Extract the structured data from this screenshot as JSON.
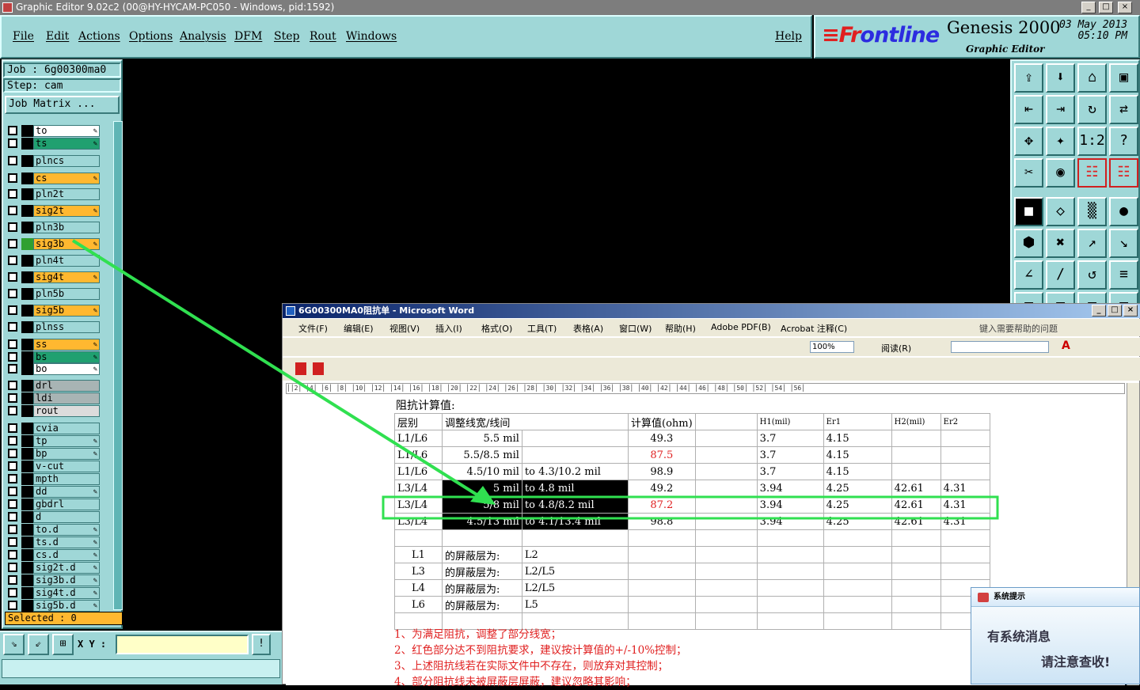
{
  "window": {
    "title": "Graphic Editor 9.02c2 (00@HY-HYCAM-PC050 - Windows, pid:1592)"
  },
  "menu": [
    "File",
    "Edit",
    "Actions",
    "Options",
    "Analysis",
    "DFM",
    "Step",
    "Rout",
    "Windows"
  ],
  "help": "Help",
  "brand": {
    "logo_a": "≡Fr",
    "logo_b": "ontline",
    "product": "Genesis 2000",
    "subtitle": "Graphic Editor",
    "date": "03 May 2013",
    "time": "05:10 PM"
  },
  "job": {
    "job": "Job : 6g00300ma0",
    "step": "Step: cam",
    "matrix": "Job Matrix ..."
  },
  "layers": [
    {
      "name": "to",
      "color": "#ffffff",
      "sw": "#000000",
      "pen": true
    },
    {
      "name": "ts",
      "color": "#20a070",
      "sw": "#000000",
      "pen": true
    },
    {
      "name": "plncs",
      "color": "#9fd7d7",
      "sw": "#000000",
      "pen": false
    },
    {
      "name": "cs",
      "color": "#ffb830",
      "sw": "#000000",
      "pen": true
    },
    {
      "name": "pln2t",
      "color": "#9fd7d7",
      "sw": "#000000",
      "pen": false
    },
    {
      "name": "sig2t",
      "color": "#ffb830",
      "sw": "#000000",
      "pen": true
    },
    {
      "name": "pln3b",
      "color": "#9fd7d7",
      "sw": "#000000",
      "pen": false
    },
    {
      "name": "sig3b",
      "color": "#ffb830",
      "sw": "#30a030",
      "pen": true
    },
    {
      "name": "pln4t",
      "color": "#9fd7d7",
      "sw": "#000000",
      "pen": false
    },
    {
      "name": "sig4t",
      "color": "#ffb830",
      "sw": "#000000",
      "pen": true
    },
    {
      "name": "pln5b",
      "color": "#9fd7d7",
      "sw": "#000000",
      "pen": false
    },
    {
      "name": "sig5b",
      "color": "#ffb830",
      "sw": "#000000",
      "pen": true
    },
    {
      "name": "plnss",
      "color": "#9fd7d7",
      "sw": "#000000",
      "pen": false
    },
    {
      "name": "ss",
      "color": "#ffb830",
      "sw": "#000000",
      "pen": true
    },
    {
      "name": "bs",
      "color": "#20a070",
      "sw": "#000000",
      "pen": true
    },
    {
      "name": "bo",
      "color": "#ffffff",
      "sw": "#000000",
      "pen": true
    },
    {
      "name": "drl",
      "color": "#a8b4b4",
      "sw": "#000000",
      "pen": false
    },
    {
      "name": "ldi",
      "color": "#a8b4b4",
      "sw": "#000000",
      "pen": false
    },
    {
      "name": "rout",
      "color": "#dcdcdc",
      "sw": "#000000",
      "pen": false
    },
    {
      "name": "cvia",
      "color": "#9fd7d7",
      "sw": "#000000",
      "pen": false
    },
    {
      "name": "tp",
      "color": "#9fd7d7",
      "sw": "#000000",
      "pen": true
    },
    {
      "name": "bp",
      "color": "#9fd7d7",
      "sw": "#000000",
      "pen": true
    },
    {
      "name": "v-cut",
      "color": "#9fd7d7",
      "sw": "#000000",
      "pen": false
    },
    {
      "name": "mpth",
      "color": "#9fd7d7",
      "sw": "#000000",
      "pen": false
    },
    {
      "name": "dd",
      "color": "#9fd7d7",
      "sw": "#000000",
      "pen": true
    },
    {
      "name": "gbdrl",
      "color": "#9fd7d7",
      "sw": "#000000",
      "pen": false
    },
    {
      "name": "d",
      "color": "#9fd7d7",
      "sw": "#000000",
      "pen": false
    },
    {
      "name": "to.d",
      "color": "#9fd7d7",
      "sw": "#000000",
      "pen": true
    },
    {
      "name": "ts.d",
      "color": "#9fd7d7",
      "sw": "#000000",
      "pen": true
    },
    {
      "name": "cs.d",
      "color": "#9fd7d7",
      "sw": "#000000",
      "pen": true
    },
    {
      "name": "sig2t.d",
      "color": "#9fd7d7",
      "sw": "#000000",
      "pen": true
    },
    {
      "name": "sig3b.d",
      "color": "#9fd7d7",
      "sw": "#000000",
      "pen": true
    },
    {
      "name": "sig4t.d",
      "color": "#9fd7d7",
      "sw": "#000000",
      "pen": true
    },
    {
      "name": "sig5b.d",
      "color": "#9fd7d7",
      "sw": "#000000",
      "pen": true
    }
  ],
  "selected": "Selected : 0",
  "xy_label": "X Y :",
  "word": {
    "title": "6G00300MA0阻抗单 - Microsoft Word",
    "menu": [
      "文件(F)",
      "编辑(E)",
      "视图(V)",
      "插入(I)",
      "格式(O)",
      "工具(T)",
      "表格(A)",
      "窗口(W)",
      "帮助(H)",
      "Adobe PDF(B)",
      "Acrobat 注释(C)"
    ],
    "help_prompt": "键入需要帮助的问题",
    "zoom": "100%",
    "read_label": "阅读(R)",
    "heading": "阻抗计算值:",
    "headers": [
      "层别",
      "调整线宽/线间",
      "计算值(ohm)",
      "H1(mil)",
      "Er1",
      "H2(mil)",
      "Er2"
    ],
    "rows": [
      {
        "layer": "L1/L6",
        "width": "5.5 mil",
        "adj": "",
        "val": "49.3",
        "red": false,
        "h1": "3.7",
        "er1": "4.15",
        "h2": "",
        "er2": "",
        "inv": false
      },
      {
        "layer": "L1/L6",
        "width": "5.5/8.5 mil",
        "adj": "",
        "val": "87.5",
        "red": true,
        "h1": "3.7",
        "er1": "4.15",
        "h2": "",
        "er2": "",
        "inv": false
      },
      {
        "layer": "L1/L6",
        "width": "4.5/10 mil",
        "adj": "to 4.3/10.2 mil",
        "val": "98.9",
        "red": false,
        "h1": "3.7",
        "er1": "4.15",
        "h2": "",
        "er2": "",
        "inv": false
      },
      {
        "layer": "L3/L4",
        "width": "5 mil",
        "adj": "to 4.8 mil",
        "val": "49.2",
        "red": false,
        "h1": "3.94",
        "er1": "4.25",
        "h2": "42.61",
        "er2": "4.31",
        "inv": true
      },
      {
        "layer": "L3/L4",
        "width": "5/8 mil",
        "adj": "to 4.8/8.2 mil",
        "val": "87.2",
        "red": true,
        "h1": "3.94",
        "er1": "4.25",
        "h2": "42.61",
        "er2": "4.31",
        "inv": true
      },
      {
        "layer": "L3/L4",
        "width": "4.5/13 mil",
        "adj": "to 4.1/13.4 mil",
        "val": "98.8",
        "red": false,
        "h1": "3.94",
        "er1": "4.25",
        "h2": "42.61",
        "er2": "4.31",
        "inv": true
      }
    ],
    "shield": [
      {
        "layer": "L1",
        "label": "的屏蔽层为:",
        "ref": "L2"
      },
      {
        "layer": "L3",
        "label": "的屏蔽层为:",
        "ref": "L2/L5"
      },
      {
        "layer": "L4",
        "label": "的屏蔽层为:",
        "ref": "L2/L5"
      },
      {
        "layer": "L6",
        "label": "的屏蔽层为:",
        "ref": "L5"
      }
    ],
    "notes": [
      "1、为满足阻抗，调整了部分线宽；",
      "2、红色部分达不到阻抗要求，建议按计算值的+/-10%控制；",
      "3、上述阻抗线若在实际文件中不存在，则放弃对其控制；",
      "4、部分阻抗线未被屏蔽层屏蔽，建议忽略其影响；"
    ]
  },
  "popup": {
    "title": "系统提示",
    "line1": "有系统消息",
    "line2": "请注意查收!"
  },
  "colors": {
    "panel": "#9fd7d7",
    "highlight": "#30e050",
    "arrow": "#30e050"
  }
}
